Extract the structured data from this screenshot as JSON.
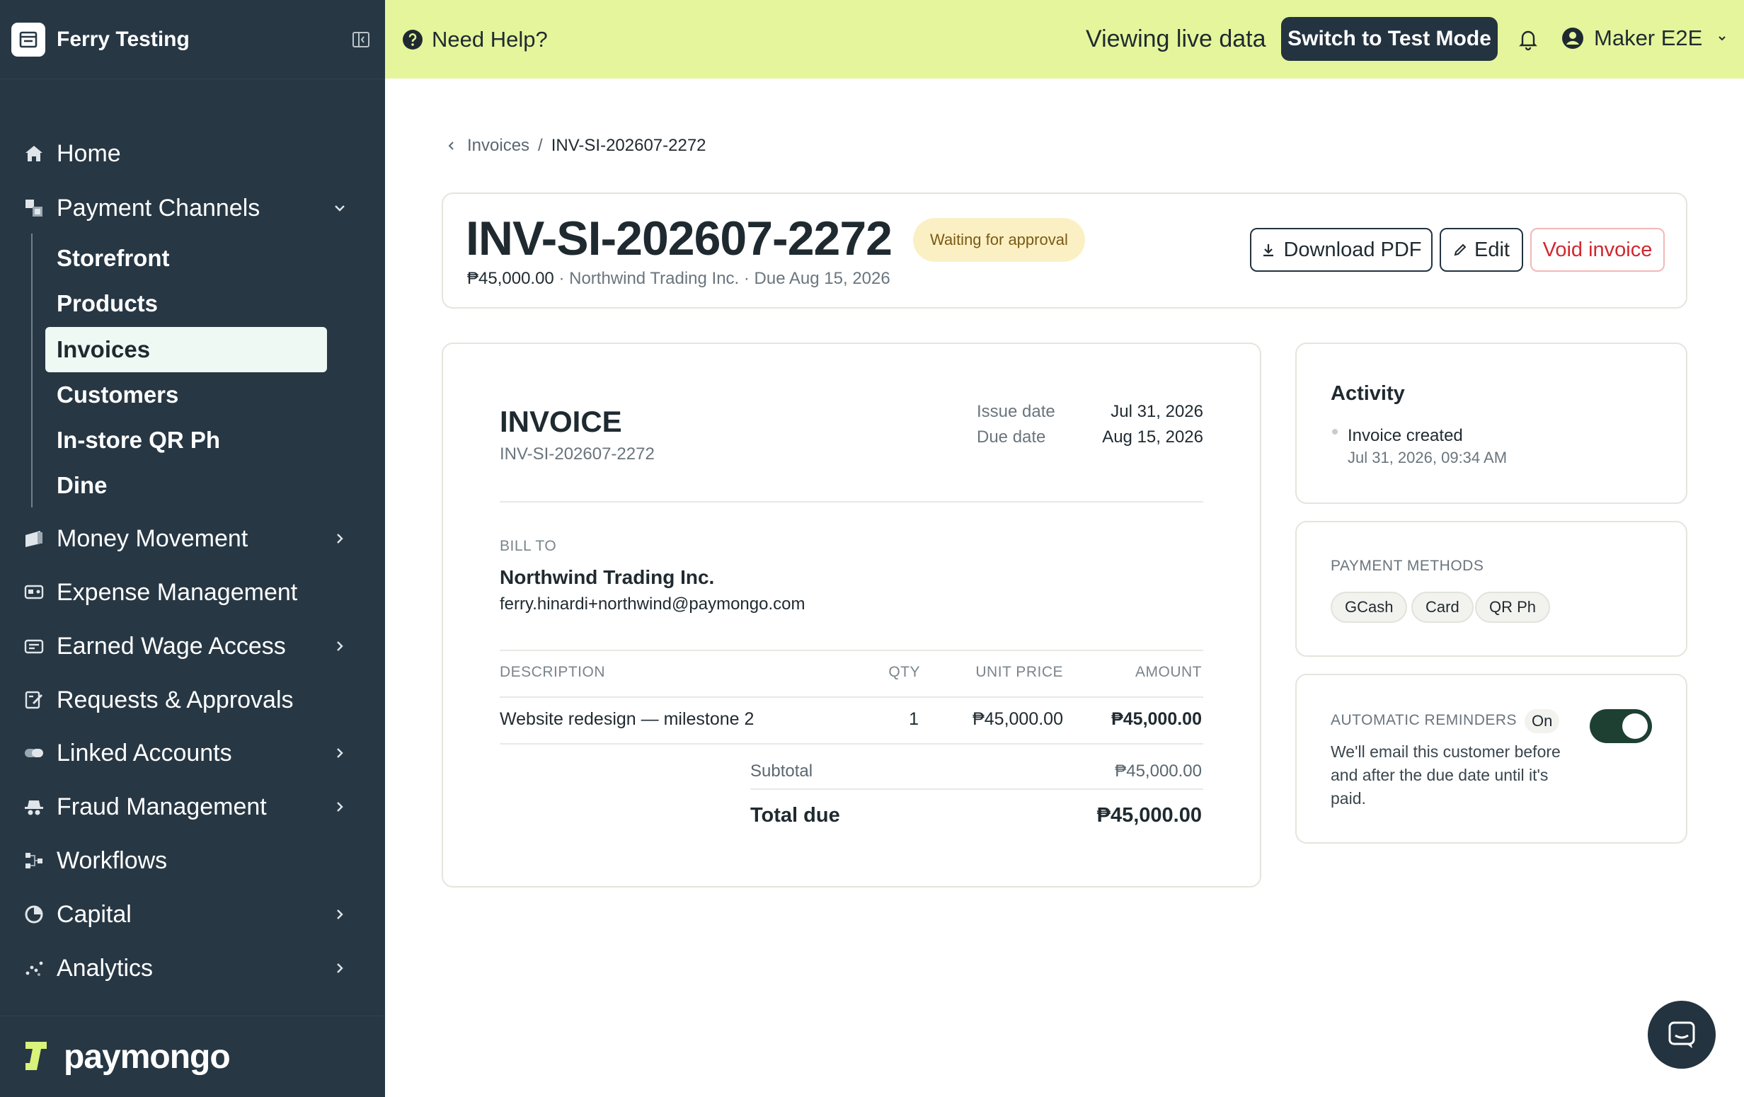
{
  "sidebar": {
    "org_name": "Ferry Testing",
    "brand": "paymongo",
    "nav": [
      {
        "label": "Home",
        "icon": "home-icon",
        "expandable": false
      },
      {
        "label": "Payment Channels",
        "icon": "payment-channels-icon",
        "expandable": true,
        "expanded": true
      },
      {
        "label": "Money Movement",
        "icon": "money-movement-icon",
        "expandable": true
      },
      {
        "label": "Expense Management",
        "icon": "expense-icon",
        "expandable": false
      },
      {
        "label": "Earned Wage Access",
        "icon": "wallet-icon",
        "expandable": true
      },
      {
        "label": "Requests & Approvals",
        "icon": "approvals-icon",
        "expandable": false
      },
      {
        "label": "Linked Accounts",
        "icon": "link-icon",
        "expandable": true
      },
      {
        "label": "Fraud Management",
        "icon": "fraud-icon",
        "expandable": true
      },
      {
        "label": "Workflows",
        "icon": "workflow-icon",
        "expandable": false
      },
      {
        "label": "Capital",
        "icon": "capital-icon",
        "expandable": true
      },
      {
        "label": "Analytics",
        "icon": "analytics-icon",
        "expandable": true
      }
    ],
    "subnav": [
      {
        "label": "Storefront"
      },
      {
        "label": "Products"
      },
      {
        "label": "Invoices",
        "active": true
      },
      {
        "label": "Customers"
      },
      {
        "label": "In-store QR Ph"
      },
      {
        "label": "Dine"
      }
    ]
  },
  "topbar": {
    "help": "Need Help?",
    "viewing": "Viewing live data",
    "switch_label": "Switch to Test Mode",
    "user_name": "Maker E2E"
  },
  "breadcrumb": {
    "parent": "Invoices",
    "separator": "/",
    "current": "INV-SI-202607-2272"
  },
  "invoice_header": {
    "number": "INV-SI-202607-2272",
    "status": "Waiting for approval",
    "amount": "₱45,000.00",
    "meta_rest": " · Northwind Trading Inc. · Due Aug 15, 2026",
    "download_label": "Download PDF",
    "edit_label": "Edit",
    "void_label": "Void invoice"
  },
  "invoice_doc": {
    "title": "INVOICE",
    "number": "INV-SI-202607-2272",
    "issue_date_label": "Issue date",
    "issue_date": "Jul 31, 2026",
    "due_date_label": "Due date",
    "due_date": "Aug 15, 2026",
    "bill_to_label": "BILL TO",
    "customer_name": "Northwind Trading Inc.",
    "customer_email": "ferry.hinardi+northwind@paymongo.com",
    "columns": {
      "description": "DESCRIPTION",
      "qty": "QTY",
      "unit_price": "UNIT PRICE",
      "amount": "AMOUNT"
    },
    "line_items": [
      {
        "description": "Website redesign — milestone 2",
        "qty": "1",
        "unit_price": "₱45,000.00",
        "amount": "₱45,000.00"
      }
    ],
    "subtotal_label": "Subtotal",
    "subtotal": "₱45,000.00",
    "total_label": "Total due",
    "total": "₱45,000.00"
  },
  "activity": {
    "title": "Activity",
    "items": [
      {
        "text": "Invoice created",
        "time": "Jul 31, 2026, 09:34 AM"
      }
    ]
  },
  "payment_methods": {
    "label": "PAYMENT METHODS",
    "chips": [
      "GCash",
      "Card",
      "QR Ph"
    ]
  },
  "reminders": {
    "label": "AUTOMATIC REMINDERS",
    "state": "On",
    "enabled": true,
    "description": "We'll email this customer before and after the due date until it's paid."
  },
  "colors": {
    "sidebar_bg": "#273744",
    "topbar_bg": "#e5f59b",
    "accent_dark": "#233340",
    "void_red": "#d2272f",
    "toggle_on": "#1d4033",
    "status_bg": "#fbf0c4"
  }
}
